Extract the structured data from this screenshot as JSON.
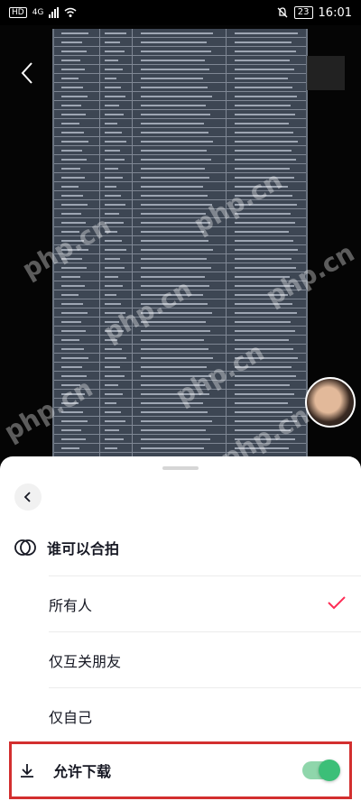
{
  "status_bar": {
    "left_badge": "HD",
    "network": "4G",
    "battery": "23",
    "time": "16:01"
  },
  "sheet": {
    "section_title": "谁可以合拍",
    "options": [
      {
        "label": "所有人",
        "selected": true
      },
      {
        "label": "仅互关朋友",
        "selected": false
      },
      {
        "label": "仅自己",
        "selected": false
      }
    ],
    "download": {
      "label": "允许下载",
      "enabled": true
    }
  },
  "watermark": "php.cn",
  "colors": {
    "accent_check": "#fe2c55",
    "toggle_on": "#3cbf78",
    "highlight_border": "#d32f2f"
  },
  "icons": {
    "back": "chevron-left-icon",
    "duet": "duet-icon",
    "download": "download-icon",
    "check": "check-icon"
  }
}
